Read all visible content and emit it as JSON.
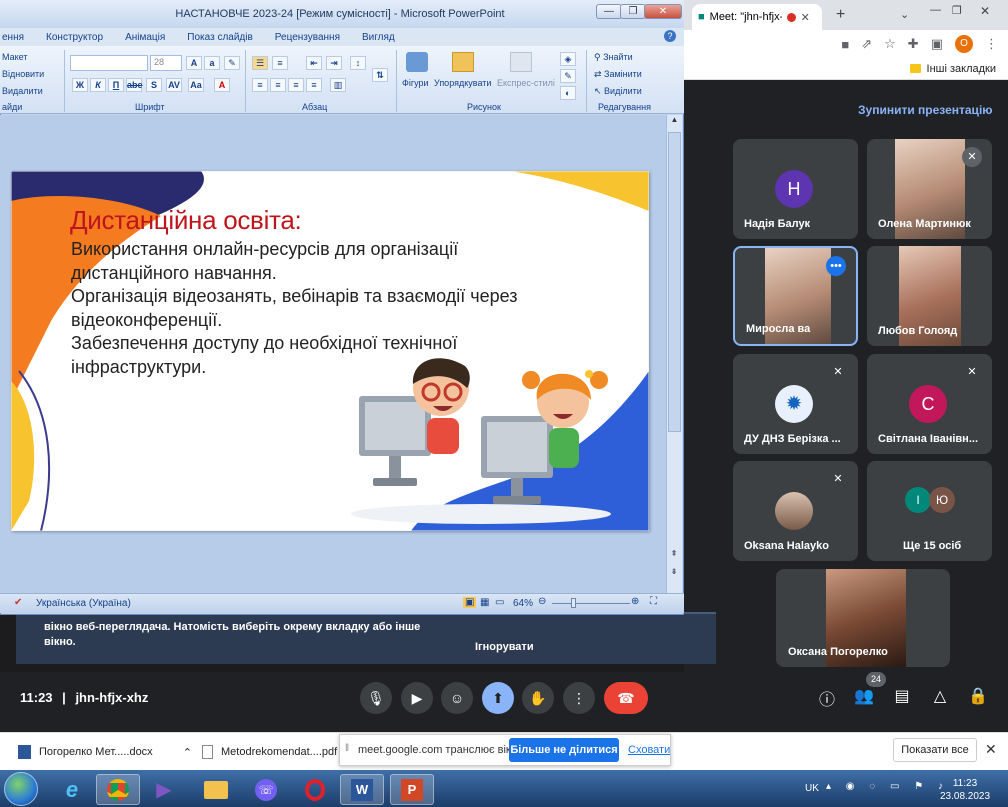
{
  "powerpoint": {
    "title": "НАСТАНОВЧЕ 2023-24 [Режим сумісності] - Microsoft PowerPoint",
    "tabs": [
      "ення",
      "Конструктор",
      "Анімація",
      "Показ слайдів",
      "Рецензування",
      "Вигляд"
    ],
    "slides_group": {
      "layout": "Макет",
      "reset": "Відновити",
      "delete": "Видалити",
      "label": "айди"
    },
    "font_group": {
      "font_size": "28",
      "label": "Шрифт"
    },
    "paragraph_group": {
      "label": "Абзац"
    },
    "drawing_group": {
      "shapes": "Фігури",
      "arrange": "Упорядкувати",
      "quick_styles": "Експрес-стилі",
      "label": "Рисунок"
    },
    "editing_group": {
      "find": "Знайти",
      "replace": "Замінити",
      "select": "Виділити",
      "label": "Редагування"
    },
    "status": {
      "language": "Українська (Україна)",
      "zoom": "64%"
    }
  },
  "slide": {
    "title": "Дистанційна освіта:",
    "lines": [
      "Використання онлайн-ресурсів для організації",
      "дистанційного навчання.",
      "Організація відеозанять, вебінарів та взаємодії через",
      "відеоконференції.",
      "Забезпечення доступу до необхідної технічної",
      "інфраструктури."
    ]
  },
  "browser": {
    "tab_title": "Meet: \"jhn-hfjx-...",
    "profile_letter": "O",
    "bookmarks_folder": "Інші закладки"
  },
  "meet": {
    "stop_presenting": "Зупинити презентацію",
    "participants": [
      {
        "name": "Надія Балук",
        "initial": "Н",
        "color": "#5e35b1"
      },
      {
        "name": "Олена Мартинюк"
      },
      {
        "name": "Миросла ва"
      },
      {
        "name": "Любов Голояд"
      },
      {
        "name": "ДУ ДНЗ Берізка ..."
      },
      {
        "name": "Світлана Іванівн...",
        "initial": "С",
        "color": "#c2185b"
      },
      {
        "name": "Oksana Halayko"
      },
      {
        "name": "Ще 15 осіб",
        "initials": [
          "І",
          "Ю"
        ]
      },
      {
        "name": "Оксана Погорелко"
      }
    ],
    "ghost_notice": "вікно веб-переглядача. Натомість виберіть окрему вкладку або інше вікно.",
    "ignore": "Ігнорувати",
    "time": "11:23",
    "separator": "|",
    "meeting_code": "jhn-hfjx-xhz",
    "people_count": "24",
    "colors": {
      "end_call": "#ea4335",
      "present_active": "#8ab4f8"
    }
  },
  "downloads": {
    "file1": "Погорелко  Мет.....docx",
    "file2": "Metodrekomendat....pdf",
    "share_text": "meet.google.com транслює вікно.",
    "stop_share": "Більше не ділитися",
    "hide": "Сховати",
    "show_all": "Показати все"
  },
  "taskbar": {
    "lang": "UK",
    "time": "11:23",
    "date": "23.08.2023"
  }
}
